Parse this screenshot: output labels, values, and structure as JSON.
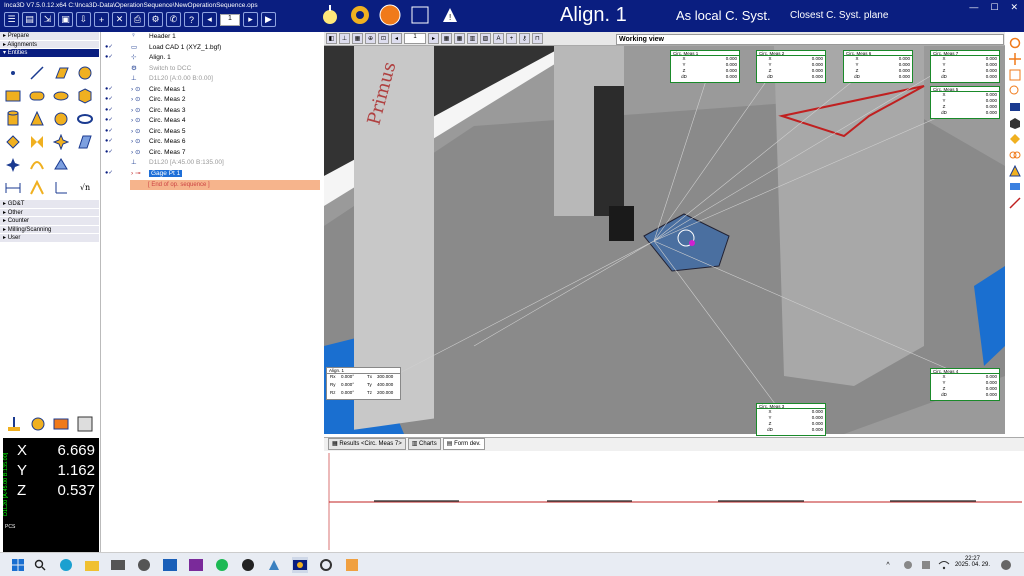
{
  "window": {
    "title": "Inca3D V7.5.0.12.x64 C:\\Inca3D-Data\\OperationSequence\\NewOperationSequence.ops",
    "step_value": "1"
  },
  "header": {
    "align_title": "Align. 1",
    "local_system": "As local C. Syst.",
    "closest_plane": "Closest C. Syst. plane"
  },
  "categories": {
    "top": [
      "Prepare",
      "Alignments",
      "Entities"
    ],
    "bottom": [
      "GD&T",
      "Other",
      "Counter",
      "Milling/Scanning",
      "User"
    ]
  },
  "readout": {
    "label": "D1L20 [A:45.00 B:135.00]",
    "rows": [
      {
        "axis": "X",
        "value": "6.669"
      },
      {
        "axis": "Y",
        "value": "1.162"
      },
      {
        "axis": "Z",
        "value": "0.537"
      }
    ],
    "pcs": "PCS"
  },
  "tree": [
    {
      "label": "Header 1",
      "status": "",
      "kind": "header"
    },
    {
      "label": "Load CAD 1  (XYZ_1.bgf)",
      "status": "●✓",
      "kind": "cad"
    },
    {
      "label": "Align. 1",
      "status": "●✓",
      "kind": "align"
    },
    {
      "label": "Switch to DCC",
      "status": "",
      "kind": "dcc",
      "disabled": true
    },
    {
      "label": "D1L20 [A:0.00 B:0.00]",
      "status": "",
      "kind": "probe",
      "disabled": true
    },
    {
      "label": "Circ. Meas 1",
      "status": "●✓",
      "kind": "circ"
    },
    {
      "label": "Circ. Meas 2",
      "status": "●✓",
      "kind": "circ"
    },
    {
      "label": "Circ. Meas 3",
      "status": "●✓",
      "kind": "circ"
    },
    {
      "label": "Circ. Meas 4",
      "status": "●✓",
      "kind": "circ"
    },
    {
      "label": "Circ. Meas 5",
      "status": "●✓",
      "kind": "circ"
    },
    {
      "label": "Circ. Meas 6",
      "status": "●✓",
      "kind": "circ"
    },
    {
      "label": "Circ. Meas 7",
      "status": "●✓",
      "kind": "circ"
    },
    {
      "label": "D1L20 [A:45.00 B:135.00]",
      "status": "",
      "kind": "probe",
      "disabled": true
    },
    {
      "label": "Gage Pt 1",
      "status": "●✓",
      "kind": "gage",
      "selected": true
    }
  ],
  "end_label": "[ End of op. sequence ]",
  "viewport": {
    "page": "1",
    "view_name": "Working view",
    "primus": "Primus"
  },
  "meas_boxes": [
    {
      "title": "Circ. Meas 1",
      "labels": [
        "X",
        "Y",
        "Z",
        "dD"
      ],
      "values": [
        "0.000",
        "0.000",
        "0.000",
        "0.000"
      ]
    },
    {
      "title": "Circ. Meas 2",
      "labels": [
        "X",
        "Y",
        "Z",
        "dD"
      ],
      "values": [
        "0.000",
        "0.000",
        "0.000",
        "0.000"
      ]
    },
    {
      "title": "Circ. Meas 6",
      "labels": [
        "X",
        "Y",
        "Z",
        "dD"
      ],
      "values": [
        "0.000",
        "0.000",
        "0.000",
        "0.000"
      ]
    },
    {
      "title": "Circ. Meas 7",
      "labels": [
        "X",
        "Y",
        "Z",
        "dD"
      ],
      "values": [
        "0.000",
        "0.000",
        "0.000",
        "0.000"
      ]
    },
    {
      "title": "Circ. Meas 5",
      "labels": [
        "X",
        "Y",
        "Z",
        "dD"
      ],
      "values": [
        "0.000",
        "0.000",
        "0.000",
        "0.000"
      ]
    },
    {
      "title": "Circ. Meas 4",
      "labels": [
        "X",
        "Y",
        "Z",
        "dD"
      ],
      "values": [
        "0.000",
        "0.000",
        "0.000",
        "0.000"
      ]
    },
    {
      "title": "Circ. Meas 3",
      "labels": [
        "X",
        "Y",
        "Z",
        "dD"
      ],
      "values": [
        "0.000",
        "0.000",
        "0.000",
        "0.000"
      ]
    }
  ],
  "align_box": {
    "title": "Align. 1",
    "rows": [
      {
        "r": "Rx",
        "rv": "0.000°",
        "t": "Tx",
        "tv": "300.000"
      },
      {
        "r": "Ry",
        "rv": "0.000°",
        "t": "Ty",
        "tv": "400.000"
      },
      {
        "r": "Rz",
        "rv": "0.000°",
        "t": "Tz",
        "tv": "200.000"
      }
    ]
  },
  "bottom_tabs": [
    "Results  <Circ. Meas 7>",
    "Charts",
    "Form dev."
  ],
  "clock": {
    "time": "22:27",
    "date": "2025. 04. 29."
  },
  "colors": {
    "brand": "#0a1e80",
    "selected": "#1e6fd8",
    "meas_green": "#1a8a2a",
    "end_row": "#f6b48c"
  }
}
